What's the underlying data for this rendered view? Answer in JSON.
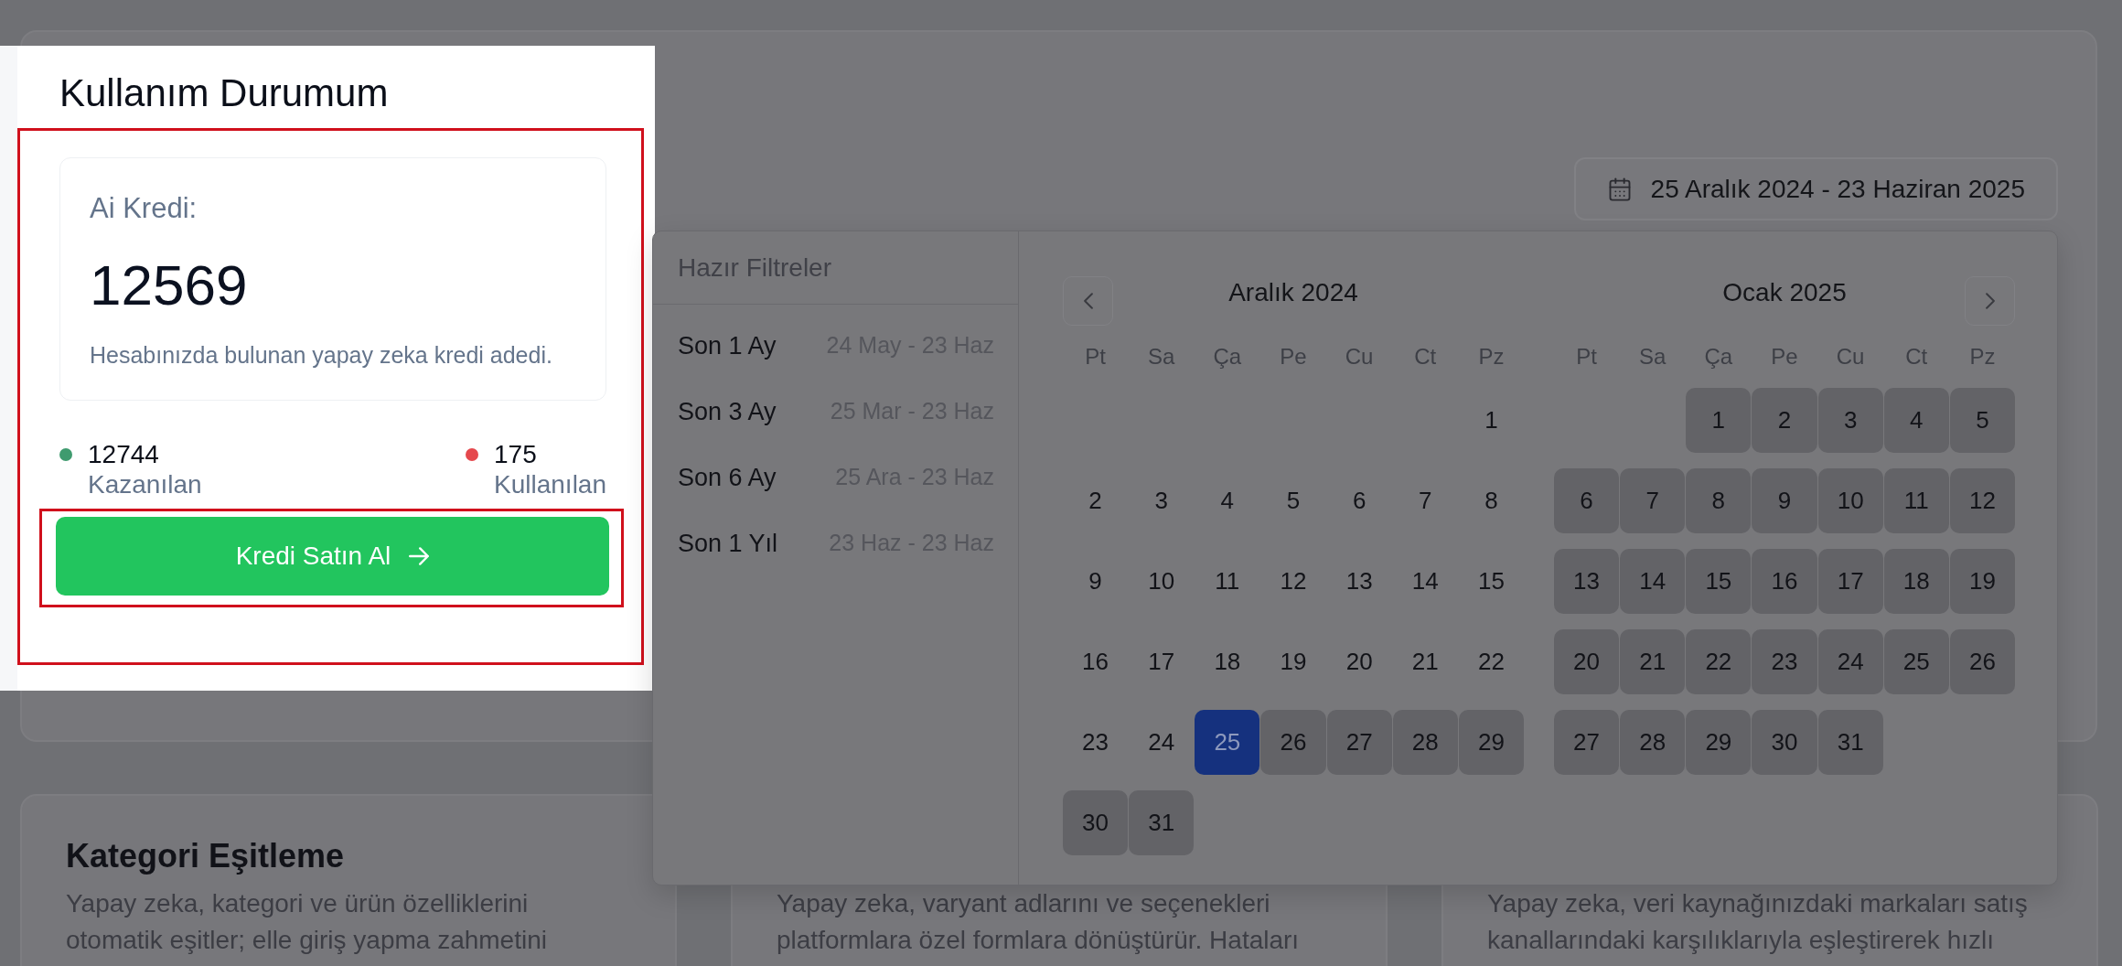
{
  "usage_panel": {
    "title": "Kullanım Durumum",
    "credit_card": {
      "label": "Ai Kredi:",
      "value": "12569",
      "description": "Hesabınızda bulunan yapay zeka kredi adedi."
    },
    "stats": [
      {
        "value": "12744",
        "label": "Kazanılan",
        "color": "#3f9b6f"
      },
      {
        "value": "175",
        "label": "Kullanılan",
        "color": "#e5484d"
      }
    ],
    "buy_button": {
      "label": "Kredi Satın Al"
    }
  },
  "date_range_button": {
    "label": "25 Aralık 2024 - 23 Haziran 2025"
  },
  "date_picker": {
    "presets_title": "Hazır Filtreler",
    "presets": [
      {
        "label": "Son 1 Ay",
        "range": "24 May - 23 Haz"
      },
      {
        "label": "Son 3 Ay",
        "range": "25 Mar - 23 Haz"
      },
      {
        "label": "Son 6 Ay",
        "range": "25 Ara - 23 Haz"
      },
      {
        "label": "Son 1 Yıl",
        "range": "23 Haz - 23 Haz"
      }
    ],
    "months": [
      {
        "title": "Aralık 2024",
        "weekdays": [
          "Pt",
          "Sa",
          "Ça",
          "Pe",
          "Cu",
          "Ct",
          "Pz"
        ],
        "weeks": [
          [
            {
              "label": "1",
              "selected": false,
              "in_range": false
            }
          ],
          [
            {
              "label": "2",
              "selected": false,
              "in_range": false
            },
            {
              "label": "3",
              "selected": false,
              "in_range": false
            },
            {
              "label": "4",
              "selected": false,
              "in_range": false
            },
            {
              "label": "5",
              "selected": false,
              "in_range": false
            },
            {
              "label": "6",
              "selected": false,
              "in_range": false
            },
            {
              "label": "7",
              "selected": false,
              "in_range": false
            },
            {
              "label": "8",
              "selected": false,
              "in_range": false
            }
          ],
          [
            {
              "label": "9",
              "selected": false,
              "in_range": false
            },
            {
              "label": "10",
              "selected": false,
              "in_range": false
            },
            {
              "label": "11",
              "selected": false,
              "in_range": false
            },
            {
              "label": "12",
              "selected": false,
              "in_range": false
            },
            {
              "label": "13",
              "selected": false,
              "in_range": false
            },
            {
              "label": "14",
              "selected": false,
              "in_range": false
            },
            {
              "label": "15",
              "selected": false,
              "in_range": false
            }
          ],
          [
            {
              "label": "16",
              "selected": false,
              "in_range": false
            },
            {
              "label": "17",
              "selected": false,
              "in_range": false
            },
            {
              "label": "18",
              "selected": false,
              "in_range": false
            },
            {
              "label": "19",
              "selected": false,
              "in_range": false
            },
            {
              "label": "20",
              "selected": false,
              "in_range": false
            },
            {
              "label": "21",
              "selected": false,
              "in_range": false
            },
            {
              "label": "22",
              "selected": false,
              "in_range": false
            }
          ],
          [
            {
              "label": "23",
              "selected": false,
              "in_range": false
            },
            {
              "label": "24",
              "selected": false,
              "in_range": false
            },
            {
              "label": "25",
              "selected": true,
              "in_range": false
            },
            {
              "label": "26",
              "selected": false,
              "in_range": true
            },
            {
              "label": "27",
              "selected": false,
              "in_range": true
            },
            {
              "label": "28",
              "selected": false,
              "in_range": true
            },
            {
              "label": "29",
              "selected": false,
              "in_range": true
            }
          ],
          [
            {
              "label": "30",
              "selected": false,
              "in_range": true
            },
            {
              "label": "31",
              "selected": false,
              "in_range": true
            }
          ]
        ]
      },
      {
        "title": "Ocak 2025",
        "weekdays": [
          "Pt",
          "Sa",
          "Ça",
          "Pe",
          "Cu",
          "Ct",
          "Pz"
        ],
        "weeks": [
          [
            {
              "label": "1",
              "selected": false,
              "in_range": true
            },
            {
              "label": "2",
              "selected": false,
              "in_range": true
            },
            {
              "label": "3",
              "selected": false,
              "in_range": true
            },
            {
              "label": "4",
              "selected": false,
              "in_range": true
            },
            {
              "label": "5",
              "selected": false,
              "in_range": true
            }
          ],
          [
            {
              "label": "6",
              "selected": false,
              "in_range": true
            },
            {
              "label": "7",
              "selected": false,
              "in_range": true
            },
            {
              "label": "8",
              "selected": false,
              "in_range": true
            },
            {
              "label": "9",
              "selected": false,
              "in_range": true
            },
            {
              "label": "10",
              "selected": false,
              "in_range": true
            },
            {
              "label": "11",
              "selected": false,
              "in_range": true
            },
            {
              "label": "12",
              "selected": false,
              "in_range": true
            }
          ],
          [
            {
              "label": "13",
              "selected": false,
              "in_range": true
            },
            {
              "label": "14",
              "selected": false,
              "in_range": true
            },
            {
              "label": "15",
              "selected": false,
              "in_range": true
            },
            {
              "label": "16",
              "selected": false,
              "in_range": true
            },
            {
              "label": "17",
              "selected": false,
              "in_range": true
            },
            {
              "label": "18",
              "selected": false,
              "in_range": true
            },
            {
              "label": "19",
              "selected": false,
              "in_range": true
            }
          ],
          [
            {
              "label": "20",
              "selected": false,
              "in_range": true
            },
            {
              "label": "21",
              "selected": false,
              "in_range": true
            },
            {
              "label": "22",
              "selected": false,
              "in_range": true
            },
            {
              "label": "23",
              "selected": false,
              "in_range": true
            },
            {
              "label": "24",
              "selected": false,
              "in_range": true
            },
            {
              "label": "25",
              "selected": false,
              "in_range": true
            },
            {
              "label": "26",
              "selected": false,
              "in_range": true
            }
          ],
          [
            {
              "label": "27",
              "selected": false,
              "in_range": true
            },
            {
              "label": "28",
              "selected": false,
              "in_range": true
            },
            {
              "label": "29",
              "selected": false,
              "in_range": true
            },
            {
              "label": "30",
              "selected": false,
              "in_range": true
            },
            {
              "label": "31",
              "selected": false,
              "in_range": true
            }
          ]
        ]
      }
    ]
  },
  "feature_cards": [
    {
      "title": "Kategori Eşitleme",
      "description": "Yapay zeka, kategori ve ürün özelliklerini otomatik eşitler; elle giriş yapma zahmetini"
    },
    {
      "description": "Yapay zeka, varyant adlarını ve seçenekleri platformlara özel formlara dönüştürür. Hataları"
    },
    {
      "description": "Yapay zeka, veri kaynağınızdaki markaları satış kanallarındaki karşılıklarıyla eşleştirerek hızlı"
    }
  ]
}
